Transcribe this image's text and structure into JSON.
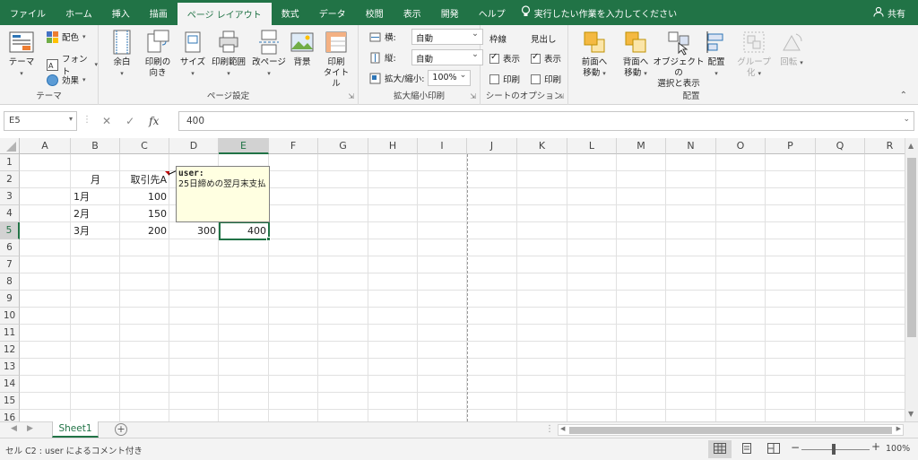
{
  "tabs": [
    "ファイル",
    "ホーム",
    "挿入",
    "描画",
    "ページ レイアウト",
    "数式",
    "データ",
    "校閲",
    "表示",
    "開発",
    "ヘルプ"
  ],
  "active_tab": "ページ レイアウト",
  "tell_me": "実行したい作業を入力してください",
  "share": "共有",
  "ribbon": {
    "theme": {
      "label": "テーマ",
      "button": "テーマ",
      "colors": "配色",
      "fonts": "フォント",
      "effects": "効果"
    },
    "page_setup": {
      "label": "ページ設定",
      "margins": "余白",
      "orientation_1": "印刷の",
      "orientation_2": "向き",
      "size": "サイズ",
      "print_area": "印刷範囲",
      "breaks": "改ページ",
      "background": "背景",
      "print_titles_1": "印刷",
      "print_titles_2": "タイトル"
    },
    "scale": {
      "label": "拡大縮小印刷",
      "width_label": "横:",
      "width_value": "自動",
      "height_label": "縦:",
      "height_value": "自動",
      "scale_label": "拡大/縮小:",
      "scale_value": "100%"
    },
    "sheet_options": {
      "label": "シートのオプション",
      "gridlines": "枠線",
      "headings": "見出し",
      "view": "表示",
      "print": "印刷"
    },
    "arrange": {
      "label": "配置",
      "bring_forward_1": "前面へ",
      "bring_forward_2": "移動",
      "send_backward_1": "背面へ",
      "send_backward_2": "移動",
      "selection_pane_1": "オブジェクトの",
      "selection_pane_2": "選択と表示",
      "align": "配置",
      "group": "グループ化",
      "rotate": "回転"
    }
  },
  "formula_bar": {
    "name_box": "E5",
    "fx": "fx",
    "value": "400"
  },
  "columns": [
    "A",
    "B",
    "C",
    "D",
    "E",
    "F",
    "G",
    "H",
    "I",
    "J",
    "K",
    "L",
    "M",
    "N",
    "O",
    "P",
    "Q",
    "R"
  ],
  "rows": [
    "1",
    "2",
    "3",
    "4",
    "5",
    "6",
    "7",
    "8",
    "9",
    "10",
    "11",
    "12",
    "13",
    "14",
    "15",
    "16"
  ],
  "cells": {
    "B2": "月",
    "C2": "取引先A",
    "B3": "1月",
    "C3": "100",
    "B4": "2月",
    "C4": "150",
    "B5": "3月",
    "C5": "200",
    "D5": "300",
    "E5": "400"
  },
  "comment": {
    "author": "user:",
    "text": "25日締めの翌月末支払"
  },
  "sheet_tab": "Sheet1",
  "status_text": "セル C2 : user によるコメント付き",
  "zoom": "100%",
  "colors": {
    "accent": "#217346",
    "comment_bg": "#ffffe1",
    "indicator": "#c00000"
  }
}
